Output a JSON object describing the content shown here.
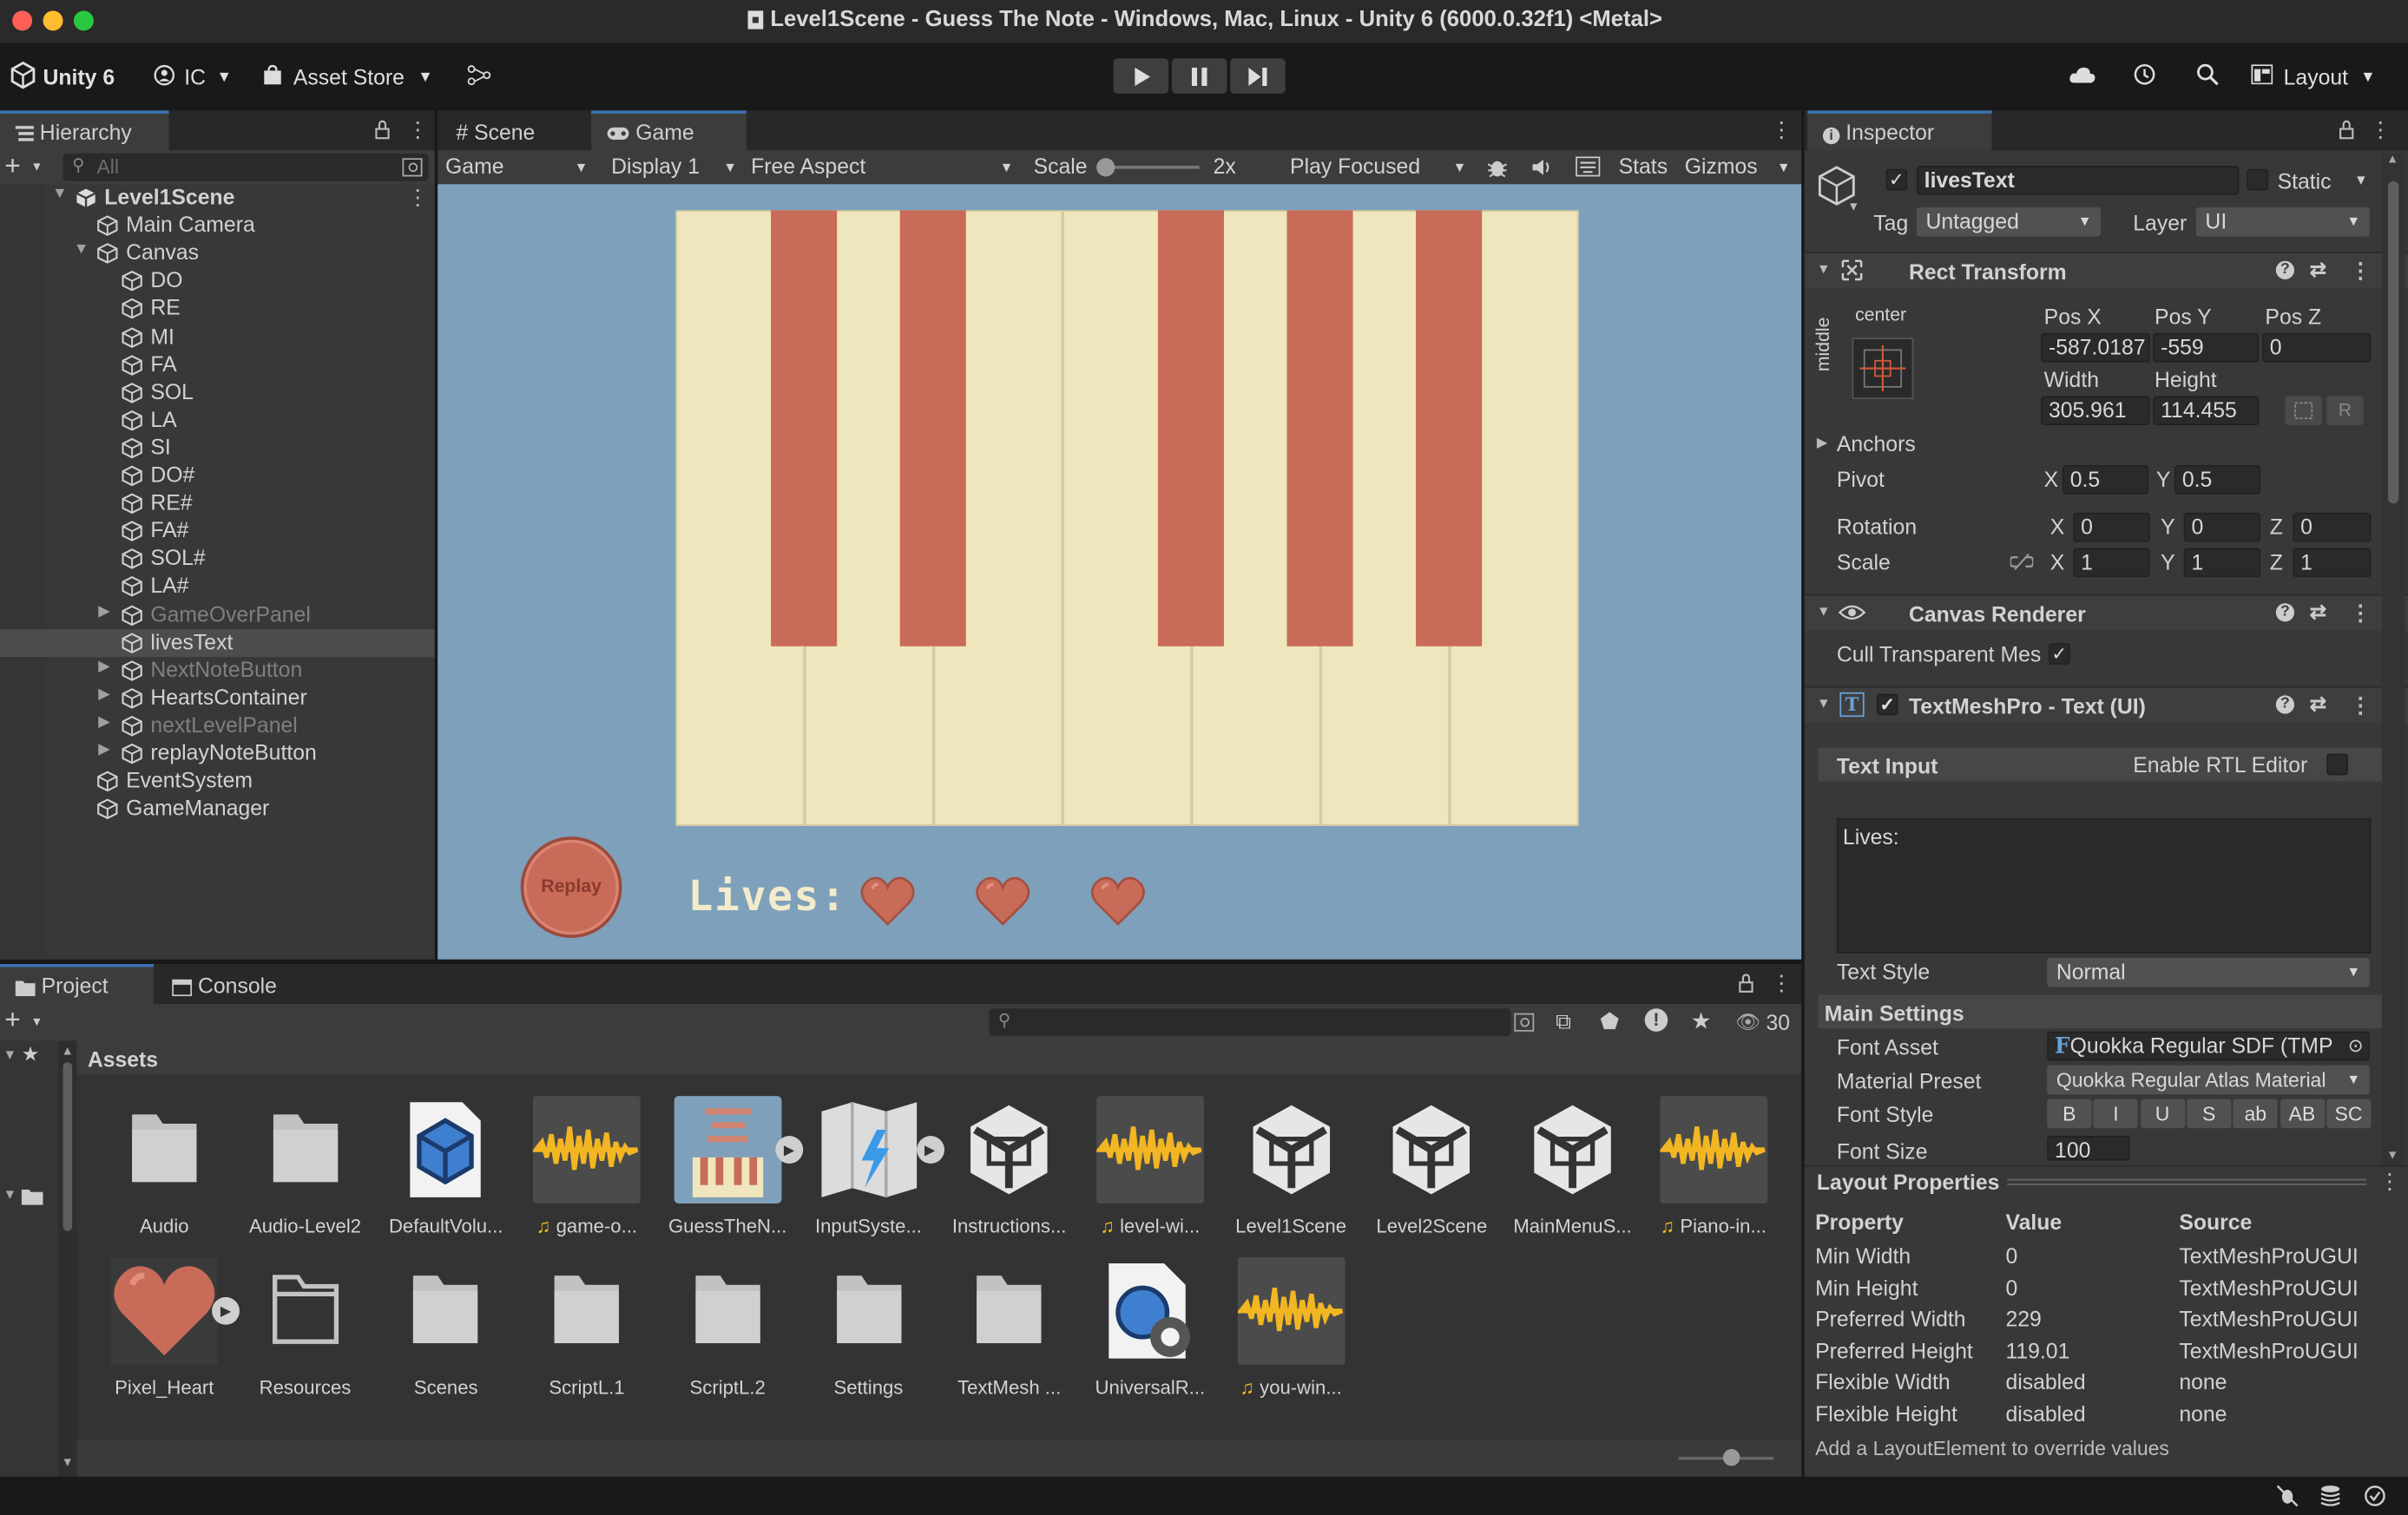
{
  "window": {
    "title": "Level1Scene - Guess The Note - Windows, Mac, Linux - Unity 6 (6000.0.32f1) <Metal>"
  },
  "toolbar": {
    "unity_label": "Unity 6",
    "account_label": "IC",
    "asset_store_label": "Asset Store",
    "layout_label": "Layout"
  },
  "hierarchy": {
    "tab_label": "Hierarchy",
    "search_placeholder": "All",
    "items": [
      {
        "label": "Level1Scene",
        "indent": 0,
        "kind": "scene",
        "expanded": true
      },
      {
        "label": "Main Camera",
        "indent": 1,
        "kind": "object"
      },
      {
        "label": "Canvas",
        "indent": 1,
        "kind": "object",
        "expanded": true
      },
      {
        "label": "DO",
        "indent": 2,
        "kind": "object"
      },
      {
        "label": "RE",
        "indent": 2,
        "kind": "object"
      },
      {
        "label": "MI",
        "indent": 2,
        "kind": "object"
      },
      {
        "label": "FA",
        "indent": 2,
        "kind": "object"
      },
      {
        "label": "SOL",
        "indent": 2,
        "kind": "object"
      },
      {
        "label": "LA",
        "indent": 2,
        "kind": "object"
      },
      {
        "label": "SI",
        "indent": 2,
        "kind": "object"
      },
      {
        "label": "DO#",
        "indent": 2,
        "kind": "object"
      },
      {
        "label": "RE#",
        "indent": 2,
        "kind": "object"
      },
      {
        "label": "FA#",
        "indent": 2,
        "kind": "object"
      },
      {
        "label": "SOL#",
        "indent": 2,
        "kind": "object"
      },
      {
        "label": "LA#",
        "indent": 2,
        "kind": "object"
      },
      {
        "label": "GameOverPanel",
        "indent": 2,
        "kind": "object",
        "collapsed": true,
        "dim": true
      },
      {
        "label": "livesText",
        "indent": 2,
        "kind": "object",
        "selected": true
      },
      {
        "label": "NextNoteButton",
        "indent": 2,
        "kind": "object",
        "collapsed": true,
        "dim": true
      },
      {
        "label": "HeartsContainer",
        "indent": 2,
        "kind": "object",
        "collapsed": true
      },
      {
        "label": "nextLevelPanel",
        "indent": 2,
        "kind": "object",
        "collapsed": true,
        "dim": true
      },
      {
        "label": "replayNoteButton",
        "indent": 2,
        "kind": "object",
        "collapsed": true
      },
      {
        "label": "EventSystem",
        "indent": 1,
        "kind": "object"
      },
      {
        "label": "GameManager",
        "indent": 1,
        "kind": "object"
      }
    ]
  },
  "game_view": {
    "tabs": [
      "Scene",
      "Game"
    ],
    "mode": "Game",
    "display": "Display 1",
    "aspect": "Free Aspect",
    "scale_label": "Scale",
    "scale_value": "2x",
    "play_mode": "Play Focused",
    "stats_label": "Stats",
    "gizmos_label": "Gizmos",
    "replay_label": "Replay",
    "lives_label": "Lives:",
    "hearts": 3,
    "white_keys": 7,
    "colors": {
      "background": "#7fa0ba",
      "white_key": "#f0e6bd",
      "black_key": "#c96b59",
      "heart": "#c96b59"
    }
  },
  "inspector": {
    "tab_label": "Inspector",
    "object_name": "livesText",
    "static_label": "Static",
    "tag_label": "Tag",
    "tag_value": "Untagged",
    "layer_label": "Layer",
    "layer_value": "UI",
    "rect_transform": {
      "title": "Rect Transform",
      "anchor_h": "center",
      "anchor_v": "middle",
      "pos_x_label": "Pos X",
      "pos_y_label": "Pos Y",
      "pos_z_label": "Pos Z",
      "pos_x": "-587.0187",
      "pos_y": "-559",
      "pos_z": "0",
      "width_label": "Width",
      "height_label": "Height",
      "width": "305.961",
      "height": "114.455",
      "r_label": "R",
      "anchors_label": "Anchors",
      "pivot_label": "Pivot",
      "pivot_x": "0.5",
      "pivot_y": "0.5",
      "rotation_label": "Rotation",
      "rot_x": "0",
      "rot_y": "0",
      "rot_z": "0",
      "scale_label": "Scale",
      "scale_x": "1",
      "scale_y": "1",
      "scale_z": "1",
      "x_label": "X",
      "y_label": "Y",
      "z_label": "Z"
    },
    "canvas_renderer": {
      "title": "Canvas Renderer",
      "cull_label": "Cull Transparent Mes"
    },
    "tmp": {
      "title": "TextMeshPro - Text (UI)",
      "text_input_label": "Text Input",
      "rtl_label": "Enable RTL Editor",
      "text_value": "Lives:",
      "text_style_label": "Text Style",
      "text_style_value": "Normal",
      "main_settings_label": "Main Settings",
      "font_asset_label": "Font Asset",
      "font_asset_value": "Quokka Regular SDF (TMP",
      "material_preset_label": "Material Preset",
      "material_preset_value": "Quokka Regular Atlas Material",
      "font_style_label": "Font Style",
      "font_style_buttons": [
        "B",
        "I",
        "U",
        "S",
        "ab",
        "AB",
        "SC"
      ],
      "font_size_label": "Font Size",
      "font_size_value": "100"
    },
    "layout_properties": {
      "title": "Layout Properties",
      "headers": [
        "Property",
        "Value",
        "Source"
      ],
      "rows": [
        [
          "Min Width",
          "0",
          "TextMeshProUGUI"
        ],
        [
          "Min Height",
          "0",
          "TextMeshProUGUI"
        ],
        [
          "Preferred Width",
          "229",
          "TextMeshProUGUI"
        ],
        [
          "Preferred Height",
          "119.01",
          "TextMeshProUGUI"
        ],
        [
          "Flexible Width",
          "disabled",
          "none"
        ],
        [
          "Flexible Height",
          "disabled",
          "none"
        ]
      ],
      "footer": "Add a LayoutElement to override values"
    }
  },
  "project": {
    "tabs": [
      "Project",
      "Console"
    ],
    "assets_label": "Assets",
    "count": "30",
    "assets": [
      {
        "label": "Audio",
        "kind": "folder"
      },
      {
        "label": "Audio-Level2",
        "kind": "folder"
      },
      {
        "label": "DefaultVolu...",
        "kind": "volume"
      },
      {
        "label": "game-o...",
        "kind": "audio"
      },
      {
        "label": "GuessTheN...",
        "kind": "image"
      },
      {
        "label": "InputSyste...",
        "kind": "input"
      },
      {
        "label": "Instructions...",
        "kind": "unity"
      },
      {
        "label": "level-wi...",
        "kind": "audio"
      },
      {
        "label": "Level1Scene",
        "kind": "unity"
      },
      {
        "label": "Level2Scene",
        "kind": "unity"
      },
      {
        "label": "MainMenuS...",
        "kind": "unity"
      },
      {
        "label": "Piano-in...",
        "kind": "audio"
      },
      {
        "label": "Pixel_Heart",
        "kind": "heart"
      },
      {
        "label": "Resources",
        "kind": "folder-outline"
      },
      {
        "label": "Scenes",
        "kind": "folder"
      },
      {
        "label": "ScriptL.1",
        "kind": "folder"
      },
      {
        "label": "ScriptL.2",
        "kind": "folder"
      },
      {
        "label": "Settings",
        "kind": "folder"
      },
      {
        "label": "TextMesh ...",
        "kind": "folder"
      },
      {
        "label": "UniversalR...",
        "kind": "render"
      },
      {
        "label": "you-win...",
        "kind": "audio"
      }
    ]
  }
}
